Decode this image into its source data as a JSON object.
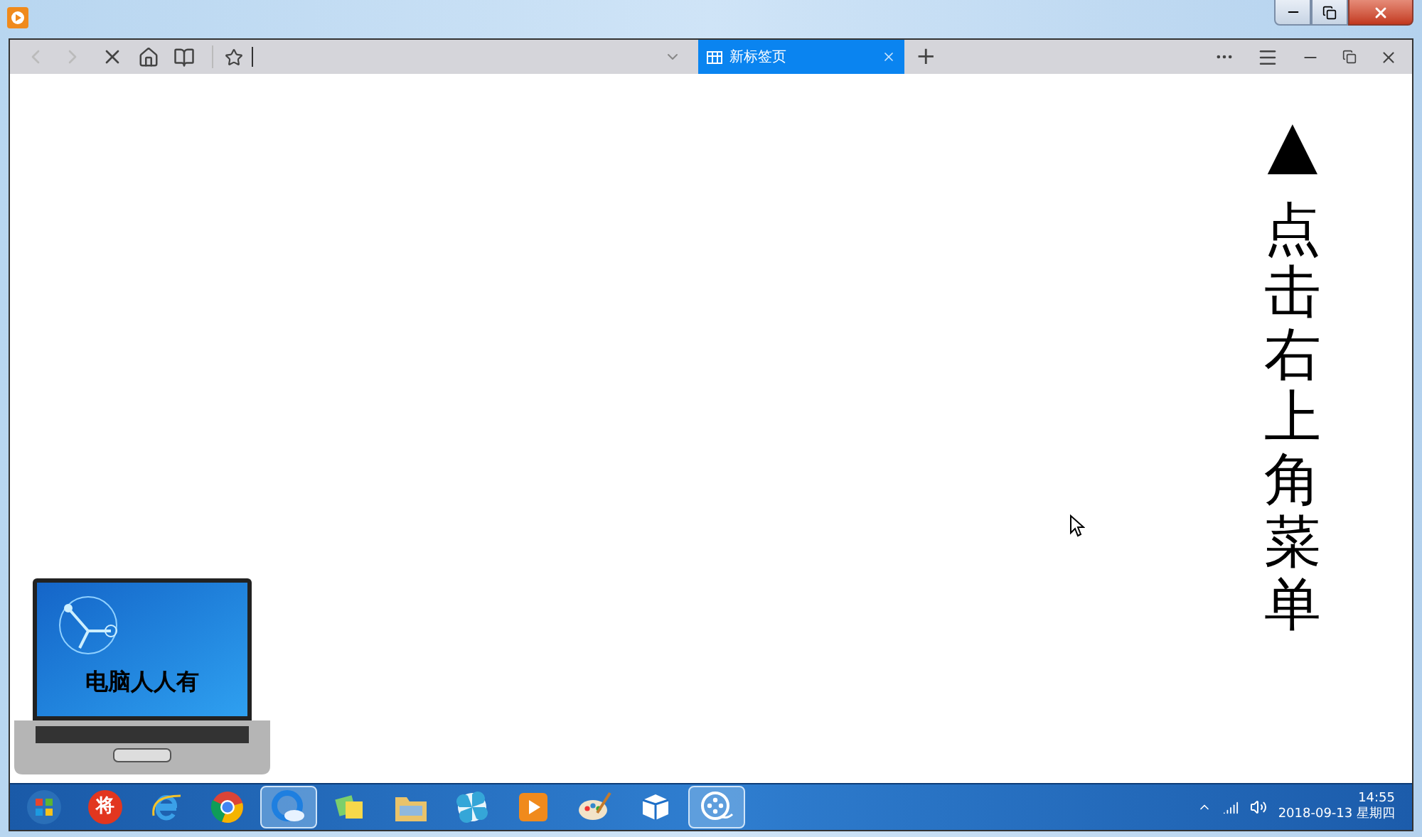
{
  "browser": {
    "tabs": [
      {
        "label": "新标签页",
        "selected": true
      }
    ],
    "new_tab": "+"
  },
  "page": {
    "arrow": "▲",
    "instruction": "点击右上角菜单"
  },
  "logo": {
    "text": "电脑人人有"
  },
  "taskbar": {
    "apps": [
      {
        "kind": "start",
        "selected": false
      },
      {
        "kind": "game",
        "selected": false,
        "glyph": "将"
      },
      {
        "kind": "ie",
        "selected": false
      },
      {
        "kind": "chrome",
        "selected": false
      },
      {
        "kind": "qbrowser",
        "selected": true
      },
      {
        "kind": "notes",
        "selected": false
      },
      {
        "kind": "folder",
        "selected": false
      },
      {
        "kind": "pinwheel",
        "selected": false
      },
      {
        "kind": "player",
        "selected": false
      },
      {
        "kind": "paint",
        "selected": false
      },
      {
        "kind": "cube",
        "selected": false
      },
      {
        "kind": "video",
        "selected": true
      }
    ],
    "time": "14:55",
    "date": "2018-09-13 星期四"
  }
}
